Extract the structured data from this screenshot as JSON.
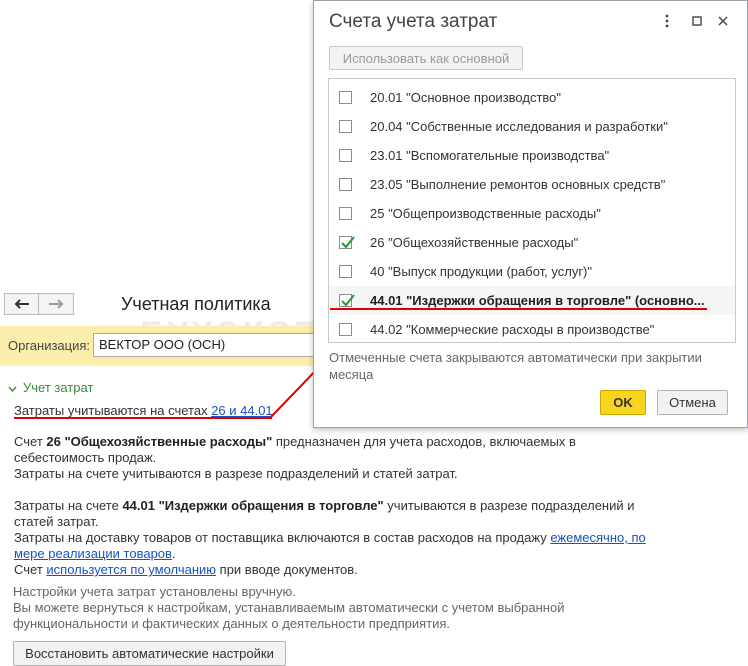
{
  "form": {
    "title": "Учетная политика",
    "watermark": "БУХЭКСПЕРТ",
    "org_label": "Организация:",
    "org_value": "ВЕКТОР ООО (ОСН)",
    "group_header": "Учет затрат",
    "line1_prefix": "Затраты учитываются на счетах ",
    "line1_link": "26 и 44.01",
    "p26_a": "Счет ",
    "p26_b": "26 \"Общехозяйственные расходы\"",
    "p26_c": " предназначен для учета расходов, включаемых в",
    "p26_d": "себестоимость продаж.",
    "p26_e": "Затраты на счете учитываются в разрезе подразделений и статей затрат.",
    "p44_a": "Затраты на счете ",
    "p44_b": "44.01 \"Издержки обращения в торговле\"",
    "p44_c": " учитываются в разрезе подразделений и",
    "p44_d": "статей затрат.",
    "delivery_prefix": "Затраты на доставку товаров от поставщика включаются в состав расходов на продажу ",
    "delivery_link1": "ежемесячно, по",
    "delivery_link2": "мере реализации товаров",
    "delivery_suffix": ".",
    "default_prefix": "Счет ",
    "default_link": "используется по умолчанию",
    "default_suffix": " при вводе документов.",
    "manual1": "Настройки учета затрат установлены вручную.",
    "manual2": "Вы можете вернуться к настройкам, устанавливаемым автоматически с учетом выбранной",
    "manual3": "функциональности и фактических данных о деятельности предприятия.",
    "restore_button": "Восстановить автоматические настройки"
  },
  "dialog": {
    "title": "Счета учета затрат",
    "use_main_button": "Использовать как основной",
    "items": [
      {
        "label": "20.01 \"Основное производство\"",
        "checked": false,
        "selected": false
      },
      {
        "label": "20.04 \"Собственные исследования и разработки\"",
        "checked": false,
        "selected": false
      },
      {
        "label": "23.01 \"Вспомогательные производства\"",
        "checked": false,
        "selected": false
      },
      {
        "label": "23.05 \"Выполнение ремонтов основных средств\"",
        "checked": false,
        "selected": false
      },
      {
        "label": "25 \"Общепроизводственные расходы\"",
        "checked": false,
        "selected": false
      },
      {
        "label": "26 \"Общехозяйственные расходы\"",
        "checked": true,
        "selected": false
      },
      {
        "label": "40 \"Выпуск продукции (работ, услуг)\"",
        "checked": false,
        "selected": false
      },
      {
        "label": "44.01 \"Издержки обращения в торговле\" (основно...",
        "checked": true,
        "selected": true
      },
      {
        "label": "44.02 \"Коммерческие расходы в производстве\"",
        "checked": false,
        "selected": false
      }
    ],
    "note": "Отмеченные счета закрываются автоматически при закрытии месяца",
    "ok_button": "OK",
    "cancel_button": "Отмена"
  },
  "colors": {
    "accent_yellow": "#f7d51c",
    "org_bar": "#fbeeaa",
    "link": "#1a52c4",
    "check_green": "#2e9c3a",
    "annotation_red": "#e00000"
  }
}
